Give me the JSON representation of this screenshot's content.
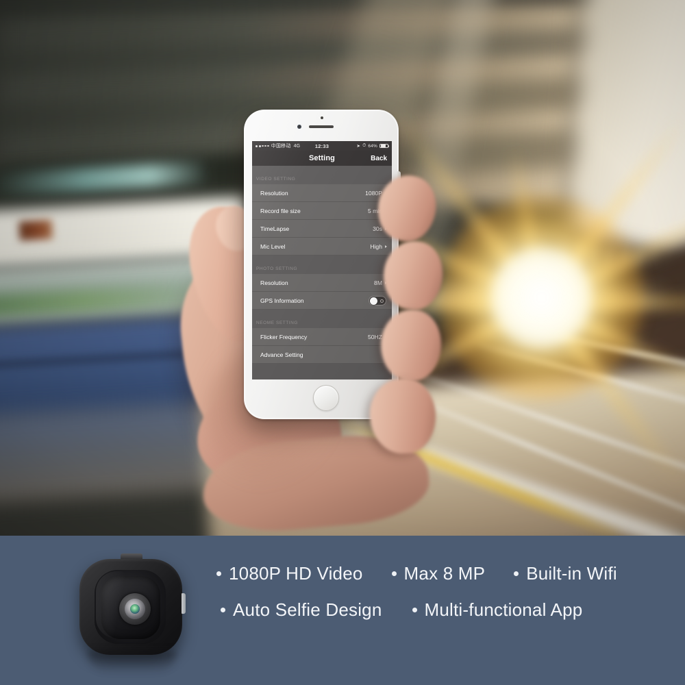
{
  "scene": {
    "description": "blurred train platform with sunburst",
    "hand_present": true
  },
  "phone": {
    "status_bar": {
      "carrier": "中国移动",
      "network": "4G",
      "time": "12:33",
      "battery_percent": "64%",
      "location_icon": "location-arrow-icon",
      "alarm_icon": "alarm-clock-icon",
      "battery_icon": "battery-icon"
    },
    "nav": {
      "title": "Setting",
      "back_label": "Back"
    },
    "sections": [
      {
        "header": "VIDEO SETTING",
        "rows": [
          {
            "label": "Resolution",
            "value": "1080P",
            "control": "chevron"
          },
          {
            "label": "Record file size",
            "value": "5 min",
            "control": "chevron"
          },
          {
            "label": "TimeLapse",
            "value": "30s",
            "control": "chevron"
          },
          {
            "label": "Mic Level",
            "value": "High",
            "control": "chevron"
          }
        ]
      },
      {
        "header": "PHOTO SETTING",
        "rows": [
          {
            "label": "Resolution",
            "value": "8M",
            "control": "chevron"
          },
          {
            "label": "GPS Information",
            "value": "",
            "control": "toggle",
            "toggle_on": false
          }
        ]
      },
      {
        "header": "NEOME SETTING",
        "rows": [
          {
            "label": "Flicker Frequency",
            "value": "50HZ",
            "control": "chevron"
          },
          {
            "label": "Advance Setting",
            "value": "",
            "control": "chevron"
          }
        ]
      }
    ]
  },
  "feature_bar": {
    "background_color": "#4c5c73",
    "product_icon": "mini-camera-icon",
    "row1": [
      "1080P HD Video",
      "Max 8 MP",
      "Built-in Wifi"
    ],
    "row2": [
      "Auto Selfie Design",
      "Multi-functional App"
    ]
  }
}
